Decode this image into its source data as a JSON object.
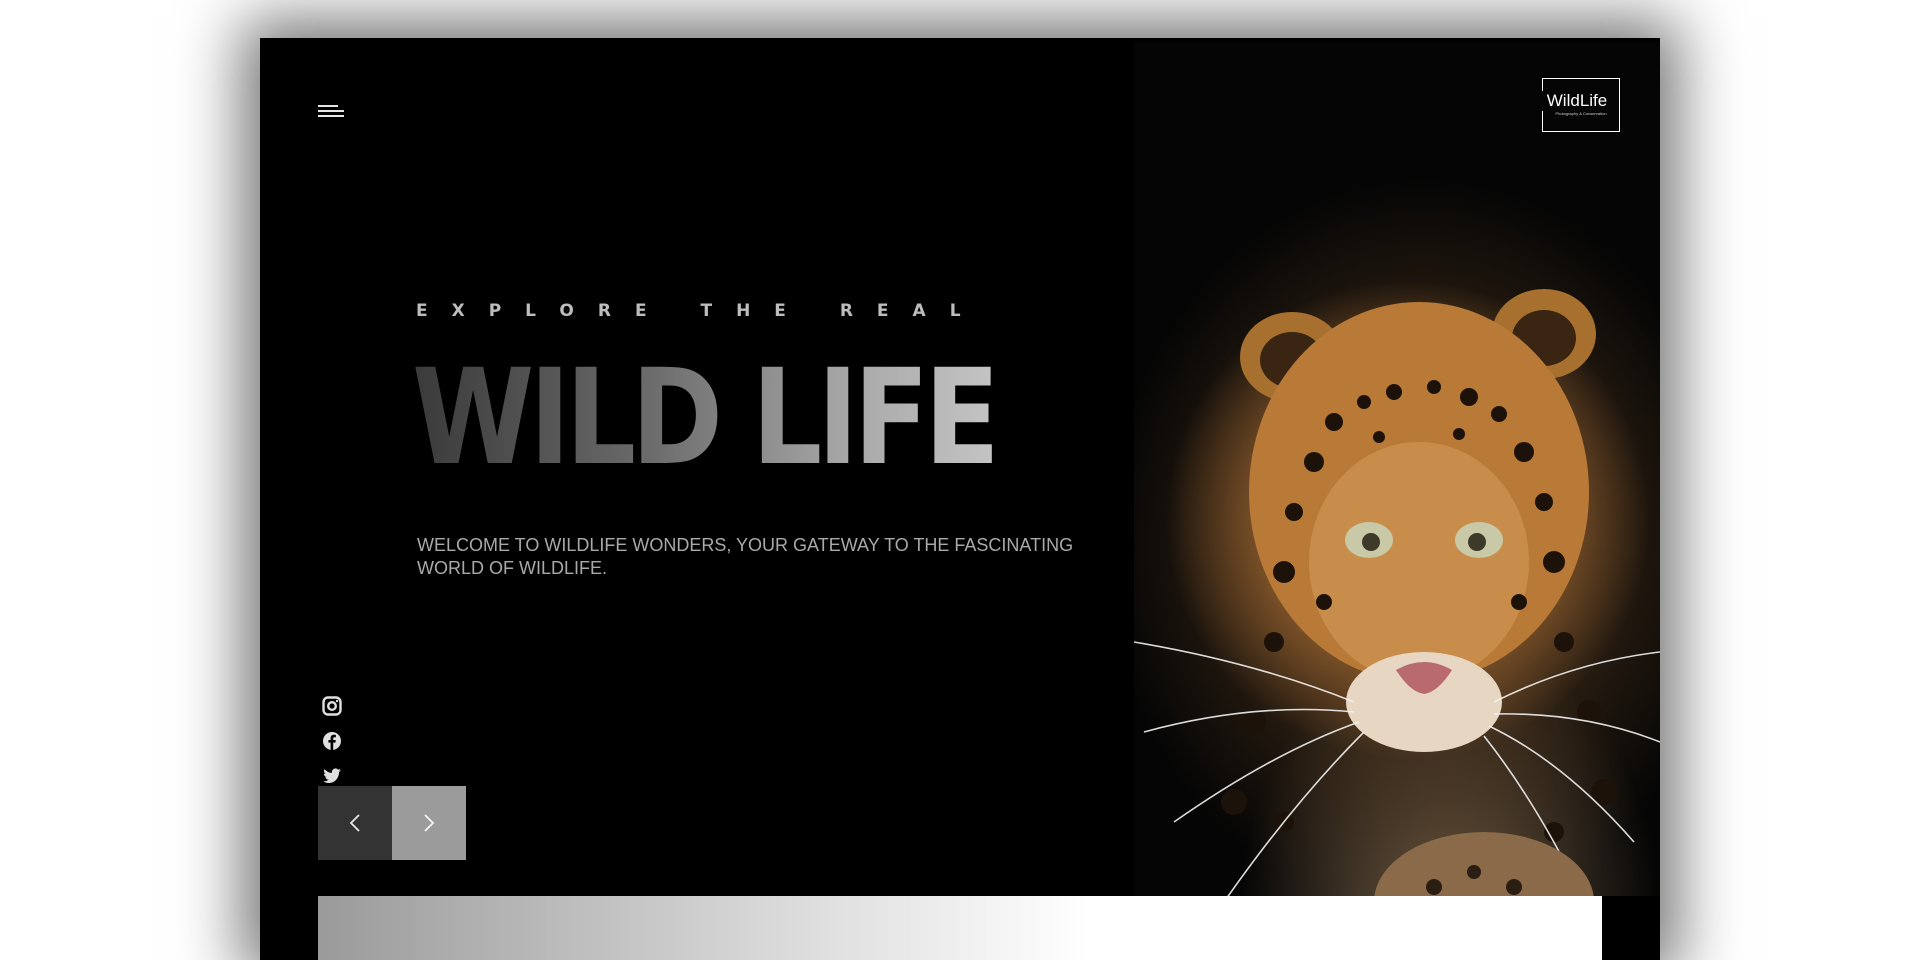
{
  "header": {
    "menu_icon": "hamburger-menu-icon",
    "logo": {
      "title": "WildLife",
      "subtitle": "Photography & Conservation"
    }
  },
  "hero": {
    "eyebrow": "EXPLORE THE REAL",
    "headline": "WILD LIFE",
    "intro": "WELCOME TO WILDLIFE WONDERS, YOUR GATEWAY TO THE FASCINATING WORLD OF WILDLIFE.",
    "image_subject": "leopard"
  },
  "socials": [
    {
      "name": "instagram",
      "icon": "instagram-icon"
    },
    {
      "name": "facebook",
      "icon": "facebook-icon"
    },
    {
      "name": "twitter",
      "icon": "twitter-icon"
    }
  ],
  "pager": {
    "prev_icon": "chevron-left-icon",
    "next_icon": "chevron-right-icon"
  },
  "colors": {
    "background": "#000000",
    "text_muted": "#a9a9a9",
    "pager_prev": "#333333",
    "pager_next": "#9b9b9b"
  }
}
